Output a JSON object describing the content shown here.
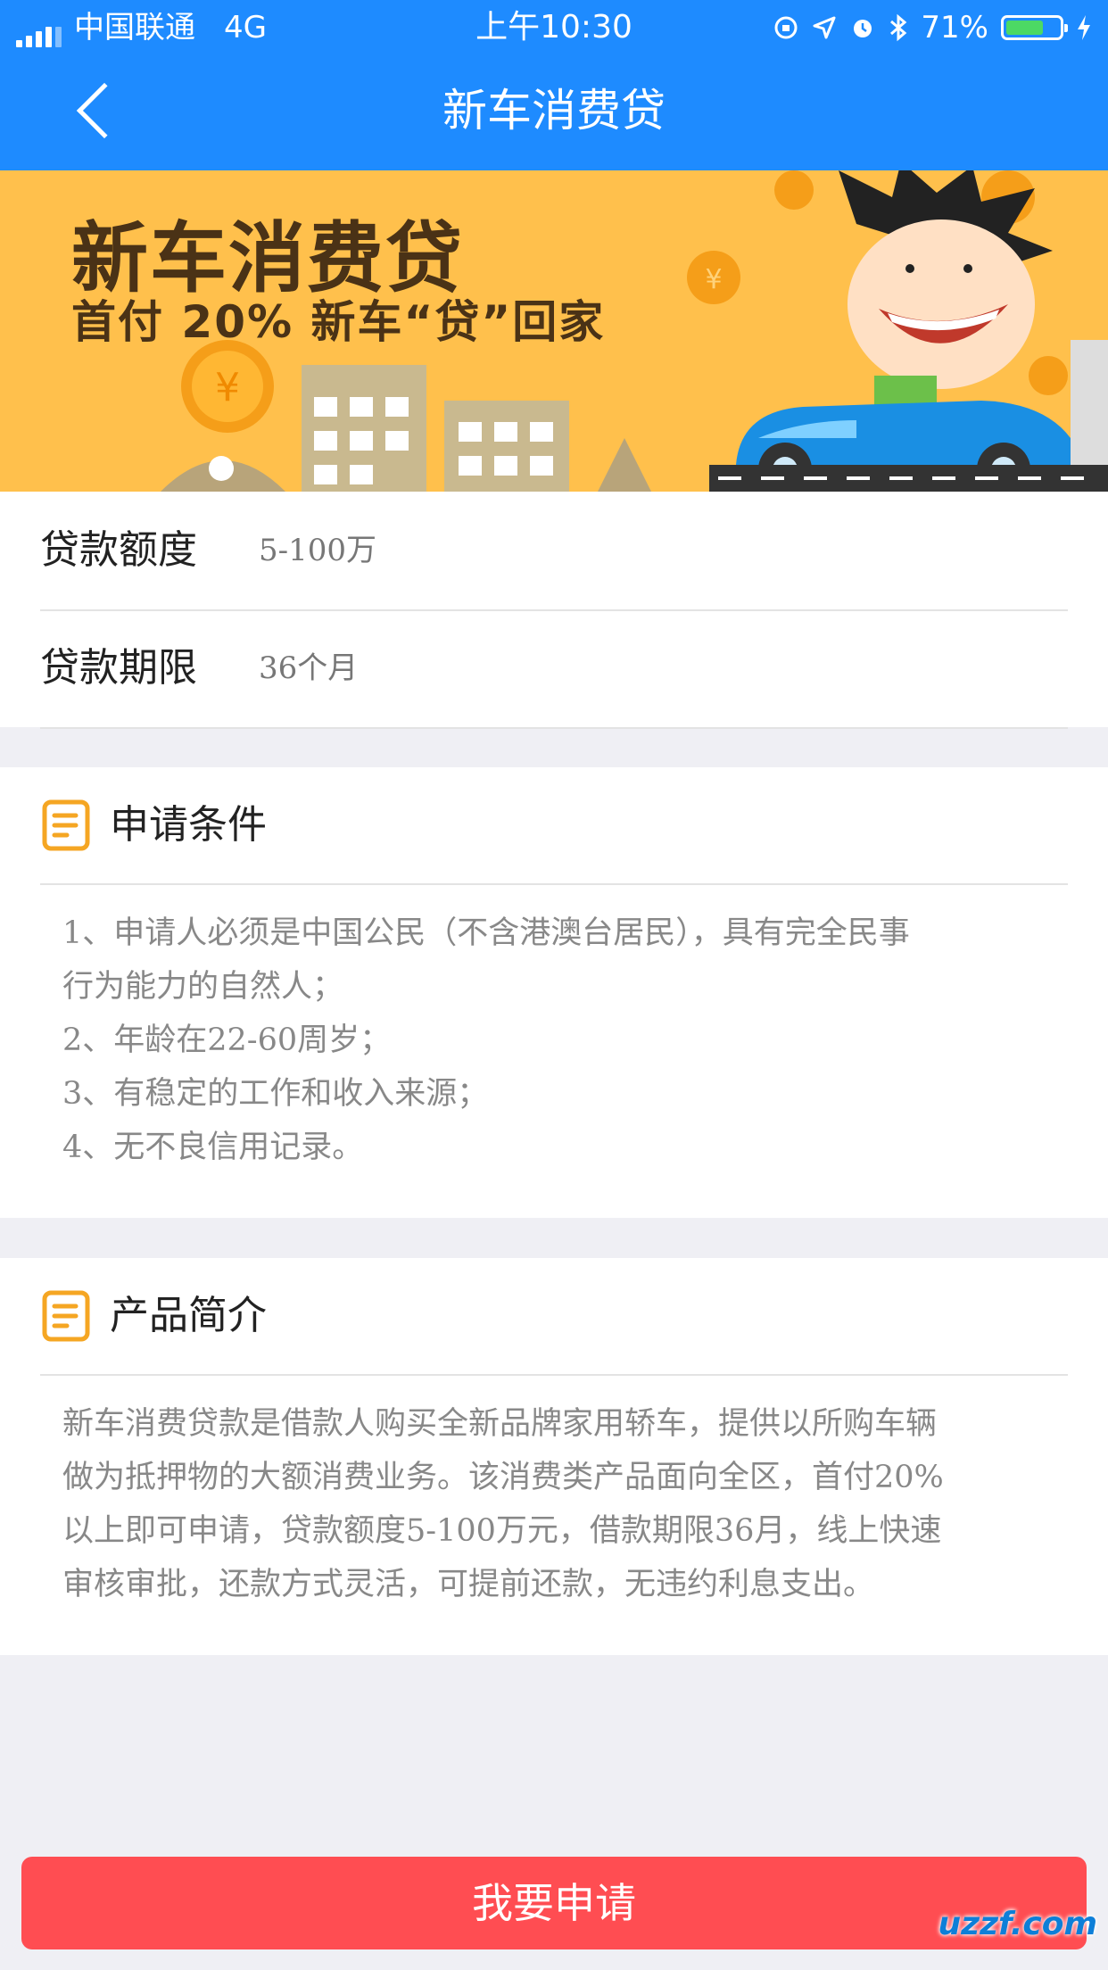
{
  "status_bar": {
    "carrier": "中国联通",
    "network": "4G",
    "time": "上午10:30",
    "battery": "71%",
    "battery_level": 0.71
  },
  "nav": {
    "title": "新车消费贷"
  },
  "banner": {
    "title": "新车消费贷",
    "subtitle": "首付 20% 新车“贷”回家"
  },
  "loan_info": {
    "amount_label": "贷款额度",
    "amount_value": "5-100万",
    "term_label": "贷款期限",
    "term_value": "36个月"
  },
  "conditions": {
    "title": "申请条件",
    "lines": [
      "1、申请人必须是中国公民（不含港澳台居民），具有完全民事",
      "行为能力的自然人；",
      "2、年龄在22-60周岁；",
      "3、有稳定的工作和收入来源；",
      "4、无不良信用记录。"
    ]
  },
  "intro": {
    "title": "产品简介",
    "lines": [
      "新车消费贷款是借款人购买全新品牌家用轿车，提供以所购车辆",
      "做为抵押物的大额消费业务。该消费类产品面向全区，首付20%",
      "以上即可申请，贷款额度5-100万元，借款期限36月，线上快速",
      "审核审批，还款方式灵活，可提前还款，无违约利息支出。"
    ]
  },
  "apply_button": {
    "label": "我要申请"
  },
  "watermark": "uzzf.com",
  "colors": {
    "nav": "#1e8bff",
    "banner": "#ffc04c",
    "accent": "#f5a623",
    "button": "#ff4d52"
  }
}
